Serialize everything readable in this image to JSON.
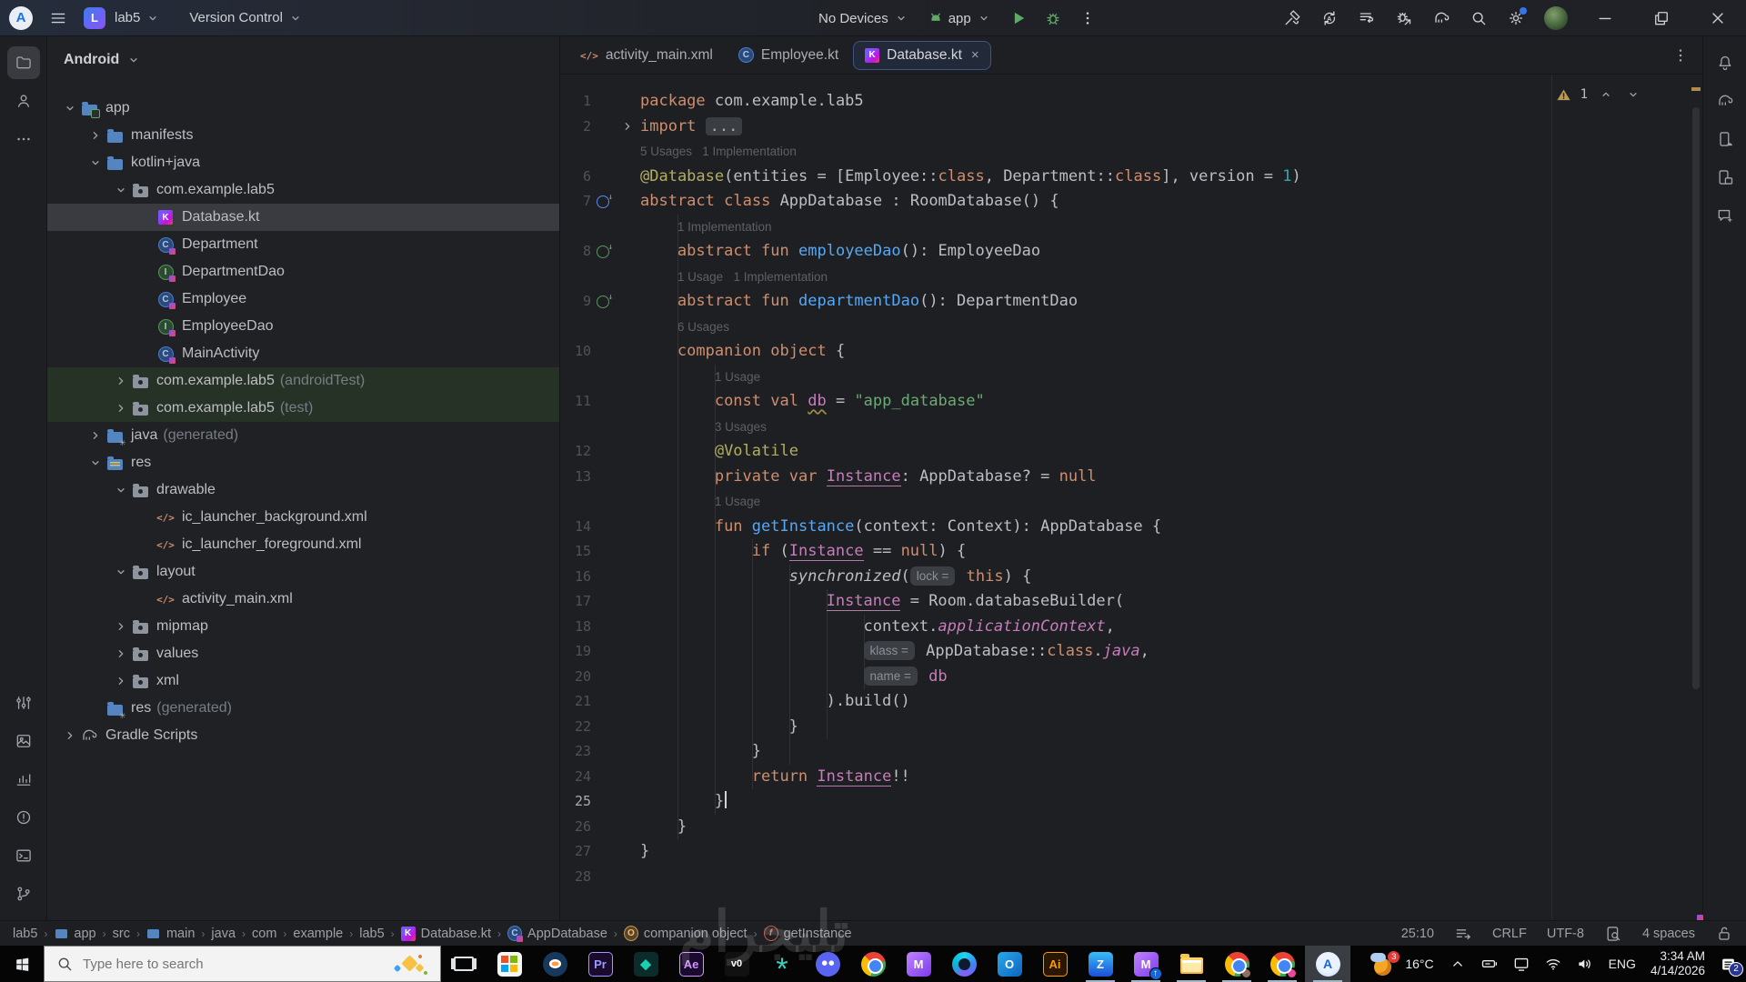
{
  "titlebar": {
    "project_initial": "L",
    "project_name": "lab5",
    "vcs_label": "Version Control",
    "device_selector": "No Devices",
    "run_config": "app",
    "right_icons": [
      {
        "name": "build-hammer"
      },
      {
        "name": "sync-project"
      },
      {
        "name": "device-list"
      },
      {
        "name": "profiler"
      },
      {
        "name": "gradle-sync"
      },
      {
        "name": "search-everywhere"
      },
      {
        "name": "settings",
        "badge": true
      },
      {
        "name": "user-avatar",
        "avatar": true
      }
    ],
    "window_controls": [
      "minimize",
      "maximize",
      "close"
    ]
  },
  "left_stripe": {
    "top": [
      {
        "name": "project",
        "active": true,
        "icon": "folder"
      },
      {
        "name": "commit",
        "icon": "person"
      },
      {
        "name": "more-tools",
        "icon": "more-horiz"
      }
    ],
    "bottom": [
      {
        "name": "build-variants",
        "icon": "sliders"
      },
      {
        "name": "resource-manager",
        "icon": "image"
      },
      {
        "name": "app-quality-insights",
        "icon": "insights"
      },
      {
        "name": "problems",
        "icon": "problems"
      },
      {
        "name": "terminal",
        "icon": "terminal"
      },
      {
        "name": "version-control",
        "icon": "branch"
      }
    ]
  },
  "right_stripe": [
    {
      "name": "notifications",
      "icon": "bell"
    },
    {
      "name": "gradle",
      "icon": "elephant"
    },
    {
      "name": "device-manager",
      "icon": "phone-android"
    },
    {
      "name": "running-devices",
      "icon": "phone-layers"
    },
    {
      "name": "gemini",
      "icon": "chat-spark"
    }
  ],
  "project_panel": {
    "header": "Android",
    "tree": [
      {
        "label": "app",
        "icon": "module-folder",
        "level": 0,
        "chev": "open"
      },
      {
        "label": "manifests",
        "icon": "folder",
        "level": 1,
        "chev": "closed"
      },
      {
        "label": "kotlin+java",
        "icon": "folder",
        "level": 1,
        "chev": "open"
      },
      {
        "label": "com.example.lab5",
        "icon": "package",
        "level": 2,
        "chev": "open"
      },
      {
        "label": "Database.kt",
        "icon": "kotlin-file",
        "level": 3,
        "selected": true
      },
      {
        "label": "Department",
        "icon": "class",
        "level": 3
      },
      {
        "label": "DepartmentDao",
        "icon": "interface",
        "level": 3
      },
      {
        "label": "Employee",
        "icon": "class",
        "level": 3
      },
      {
        "label": "EmployeeDao",
        "icon": "interface",
        "level": 3
      },
      {
        "label": "MainActivity",
        "icon": "class",
        "level": 3
      },
      {
        "label": "com.example.lab5",
        "suffix": "(androidTest)",
        "icon": "package",
        "level": 2,
        "chev": "closed",
        "highlight": true
      },
      {
        "label": "com.example.lab5",
        "suffix": "(test)",
        "icon": "package",
        "level": 2,
        "chev": "closed",
        "highlight": true
      },
      {
        "label": "java",
        "suffix": "(generated)",
        "icon": "gen-folder",
        "level": 1,
        "chev": "closed"
      },
      {
        "label": "res",
        "icon": "res-folder",
        "level": 1,
        "chev": "open"
      },
      {
        "label": "drawable",
        "icon": "package",
        "level": 2,
        "chev": "open"
      },
      {
        "label": "ic_launcher_background.xml",
        "icon": "xml-file",
        "level": 3
      },
      {
        "label": "ic_launcher_foreground.xml",
        "icon": "xml-file",
        "level": 3
      },
      {
        "label": "layout",
        "icon": "package",
        "level": 2,
        "chev": "open"
      },
      {
        "label": "activity_main.xml",
        "icon": "xml-file",
        "level": 3
      },
      {
        "label": "mipmap",
        "icon": "package",
        "level": 2,
        "chev": "closed"
      },
      {
        "label": "values",
        "icon": "package",
        "level": 2,
        "chev": "closed"
      },
      {
        "label": "xml",
        "icon": "package",
        "level": 2,
        "chev": "closed"
      },
      {
        "label": "res",
        "suffix": "(generated)",
        "icon": "gen-folder",
        "level": 1
      },
      {
        "label": "Gradle Scripts",
        "icon": "gradle",
        "level": 0,
        "chev": "closed"
      }
    ]
  },
  "editor": {
    "tabs": [
      {
        "label": "activity_main.xml",
        "icon": "xml-file"
      },
      {
        "label": "Employee.kt",
        "icon": "class"
      },
      {
        "label": "Database.kt",
        "icon": "kotlin-file",
        "selected": true,
        "closable": true
      }
    ],
    "inspection": {
      "warnings": "1"
    },
    "rows": [
      {
        "t": "c",
        "n": "1",
        "ind": 0,
        "tk": [
          [
            "kw",
            "package"
          ],
          [
            "pl",
            " com.example.lab5"
          ]
        ]
      },
      {
        "t": "c",
        "n": "2",
        "ind": 0,
        "fold": true,
        "tk": [
          [
            "kw",
            "import"
          ],
          [
            "pl",
            " "
          ],
          [
            "fold",
            "..."
          ]
        ]
      },
      {
        "t": "h",
        "ind": 0,
        "text": "5 Usages   1 Implementation"
      },
      {
        "t": "c",
        "n": "6",
        "ind": 0,
        "tk": [
          [
            "ann",
            "@Database"
          ],
          [
            "pl",
            "(entities = [Employee::"
          ],
          [
            "kw",
            "class"
          ],
          [
            "pl",
            ", Department::"
          ],
          [
            "kw",
            "class"
          ],
          [
            "pl",
            "], version = "
          ],
          [
            "num",
            "1"
          ],
          [
            "pl",
            ")"
          ]
        ]
      },
      {
        "t": "c",
        "n": "7",
        "g": "cls",
        "ind": 0,
        "tk": [
          [
            "kw",
            "abstract"
          ],
          [
            "pl",
            " "
          ],
          [
            "kw",
            "class"
          ],
          [
            "pl",
            " AppDatabase : RoomDatabase() {"
          ]
        ]
      },
      {
        "t": "h",
        "ind": 1,
        "text": "1 Implementation"
      },
      {
        "t": "c",
        "n": "8",
        "g": "ifc",
        "ind": 1,
        "tk": [
          [
            "kw",
            "abstract"
          ],
          [
            "pl",
            " "
          ],
          [
            "kw",
            "fun"
          ],
          [
            "pl",
            " "
          ],
          [
            "fn",
            "employeeDao"
          ],
          [
            "pl",
            "(): EmployeeDao"
          ]
        ]
      },
      {
        "t": "h",
        "ind": 1,
        "text": "1 Usage   1 Implementation"
      },
      {
        "t": "c",
        "n": "9",
        "g": "ifc",
        "ind": 1,
        "tk": [
          [
            "kw",
            "abstract"
          ],
          [
            "pl",
            " "
          ],
          [
            "kw",
            "fun"
          ],
          [
            "pl",
            " "
          ],
          [
            "fn",
            "departmentDao"
          ],
          [
            "pl",
            "(): DepartmentDao"
          ]
        ]
      },
      {
        "t": "h",
        "ind": 1,
        "text": "6 Usages"
      },
      {
        "t": "c",
        "n": "10",
        "ind": 1,
        "tk": [
          [
            "kw",
            "companion"
          ],
          [
            "pl",
            " "
          ],
          [
            "kw",
            "object"
          ],
          [
            "pl",
            " {"
          ]
        ]
      },
      {
        "t": "h",
        "ind": 2,
        "text": "1 Usage"
      },
      {
        "t": "c",
        "n": "11",
        "ind": 2,
        "tk": [
          [
            "kw",
            "const"
          ],
          [
            "pl",
            " "
          ],
          [
            "kw",
            "val"
          ],
          [
            "pl",
            " "
          ],
          [
            "propW",
            "db"
          ],
          [
            "pl",
            " = "
          ],
          [
            "str",
            "\"app_database\""
          ]
        ]
      },
      {
        "t": "h",
        "ind": 2,
        "text": "3 Usages"
      },
      {
        "t": "c",
        "n": "12",
        "ind": 2,
        "tk": [
          [
            "ann",
            "@Volatile"
          ]
        ]
      },
      {
        "t": "c",
        "n": "13",
        "ind": 2,
        "tk": [
          [
            "kw",
            "private"
          ],
          [
            "pl",
            " "
          ],
          [
            "kw",
            "var"
          ],
          [
            "pl",
            " "
          ],
          [
            "propU",
            "Instance"
          ],
          [
            "pl",
            ": AppDatabase? = "
          ],
          [
            "kw",
            "null"
          ]
        ]
      },
      {
        "t": "h",
        "ind": 2,
        "text": "1 Usage"
      },
      {
        "t": "c",
        "n": "14",
        "ind": 2,
        "tk": [
          [
            "kw",
            "fun"
          ],
          [
            "pl",
            " "
          ],
          [
            "fn",
            "getInstance"
          ],
          [
            "pl",
            "(context: Context): AppDatabase {"
          ]
        ]
      },
      {
        "t": "c",
        "n": "15",
        "ind": 3,
        "tk": [
          [
            "kw",
            "if"
          ],
          [
            "pl",
            " ("
          ],
          [
            "propU",
            "Instance"
          ],
          [
            "pl",
            " == "
          ],
          [
            "kw",
            "null"
          ],
          [
            "pl",
            ") {"
          ]
        ]
      },
      {
        "t": "c",
        "n": "16",
        "ind": 4,
        "tk": [
          [
            "it",
            "synchronized"
          ],
          [
            "pl",
            "("
          ],
          [
            "inlay",
            "lock ="
          ],
          [
            "pl",
            " "
          ],
          [
            "kw",
            "this"
          ],
          [
            "pl",
            ") {"
          ]
        ]
      },
      {
        "t": "c",
        "n": "17",
        "ind": 5,
        "tk": [
          [
            "propU",
            "Instance"
          ],
          [
            "pl",
            " = Room.databaseBuilder("
          ]
        ]
      },
      {
        "t": "c",
        "n": "18",
        "ind": 6,
        "tk": [
          [
            "pl",
            "context."
          ],
          [
            "propI",
            "applicationContext"
          ],
          [
            "pl",
            ","
          ]
        ]
      },
      {
        "t": "c",
        "n": "19",
        "ind": 6,
        "tk": [
          [
            "inlay",
            "klass ="
          ],
          [
            "pl",
            " AppDatabase::"
          ],
          [
            "kw",
            "class"
          ],
          [
            "pl",
            "."
          ],
          [
            "propI",
            "java"
          ],
          [
            "pl",
            ","
          ]
        ]
      },
      {
        "t": "c",
        "n": "20",
        "ind": 6,
        "tk": [
          [
            "inlay",
            "name ="
          ],
          [
            "pl",
            " "
          ],
          [
            "prop",
            "db"
          ]
        ]
      },
      {
        "t": "c",
        "n": "21",
        "ind": 5,
        "tk": [
          [
            "pl",
            ").build()"
          ]
        ]
      },
      {
        "t": "c",
        "n": "22",
        "ind": 4,
        "tk": [
          [
            "pl",
            "}"
          ]
        ]
      },
      {
        "t": "c",
        "n": "23",
        "ind": 3,
        "tk": [
          [
            "pl",
            "}"
          ]
        ]
      },
      {
        "t": "c",
        "n": "24",
        "ind": 3,
        "tk": [
          [
            "kw",
            "return"
          ],
          [
            "pl",
            " "
          ],
          [
            "propU",
            "Instance"
          ],
          [
            "pl",
            "!!"
          ]
        ]
      },
      {
        "t": "c",
        "n": "25",
        "ind": 2,
        "cur": true,
        "caret": true,
        "tk": [
          [
            "pl",
            "}"
          ]
        ]
      },
      {
        "t": "c",
        "n": "26",
        "ind": 1,
        "tk": [
          [
            "pl",
            "}"
          ]
        ]
      },
      {
        "t": "c",
        "n": "27",
        "ind": 0,
        "tk": [
          [
            "pl",
            "}"
          ]
        ]
      },
      {
        "t": "c",
        "n": "28",
        "ind": 0,
        "tk": []
      }
    ]
  },
  "breadcrumbs": [
    {
      "label": "lab5"
    },
    {
      "label": "app",
      "icon": "module"
    },
    {
      "label": "src"
    },
    {
      "label": "main",
      "icon": "module"
    },
    {
      "label": "java"
    },
    {
      "label": "com"
    },
    {
      "label": "example"
    },
    {
      "label": "lab5"
    },
    {
      "label": "Database.kt",
      "icon": "kotlin-file"
    },
    {
      "label": "AppDatabase",
      "icon": "class"
    },
    {
      "label": "companion object",
      "icon": "object"
    },
    {
      "label": "getInstance",
      "icon": "function"
    }
  ],
  "status_right": [
    {
      "name": "caret-position",
      "label": "25:10"
    },
    {
      "name": "code-style",
      "icon": "code-style"
    },
    {
      "name": "line-ending",
      "label": "CRLF"
    },
    {
      "name": "encoding",
      "label": "UTF-8"
    },
    {
      "name": "inspect-file",
      "icon": "file-inspect"
    },
    {
      "name": "indentation",
      "label": "4 spaces"
    },
    {
      "name": "file-lock",
      "icon": "lock-open"
    }
  ],
  "taskbar": {
    "search_placeholder": "Type here to search",
    "apps": [
      {
        "name": "task-view"
      },
      {
        "name": "microsoft-store"
      },
      {
        "name": "blender"
      },
      {
        "name": "premiere-pro",
        "glyph": "Pr"
      },
      {
        "name": "filmora",
        "glyph": "◆"
      },
      {
        "name": "after-effects",
        "glyph": "Ae"
      },
      {
        "name": "v0",
        "glyph": "v0"
      },
      {
        "name": "starburst",
        "glyph": "*"
      },
      {
        "name": "discord"
      },
      {
        "name": "chrome"
      },
      {
        "name": "purple-m-app",
        "glyph": "M"
      },
      {
        "name": "copilot"
      },
      {
        "name": "outlook",
        "glyph": "O"
      },
      {
        "name": "illustrator",
        "glyph": "Ai"
      },
      {
        "name": "blue-z-app",
        "glyph": "Z",
        "open": true
      },
      {
        "name": "m-updater-app",
        "glyph": "M",
        "open": true
      },
      {
        "name": "file-explorer",
        "open": true
      },
      {
        "name": "chrome-profile-1",
        "open": true
      },
      {
        "name": "chrome-profile-2",
        "open": true
      },
      {
        "name": "android-studio",
        "glyph": "A",
        "active": true,
        "open": true
      }
    ],
    "tray": {
      "weather_badge": "3",
      "temperature": "16°C",
      "icons": [
        "chevron-up",
        "battery",
        "cast",
        "wifi",
        "volume"
      ],
      "language": "ENG",
      "time": "3:34 AM",
      "date": "4/14/2026",
      "notification_count": "2"
    }
  },
  "watermark": {
    "text": "تليجرام"
  },
  "colors": {
    "accent": "#3574f0",
    "run_green": "#57965c",
    "keyword": "#cf8e6d",
    "function": "#56a8f5",
    "string": "#6aab73",
    "annotation": "#b3ae60",
    "property": "#c77dbb",
    "warning": "#b08c4f"
  }
}
